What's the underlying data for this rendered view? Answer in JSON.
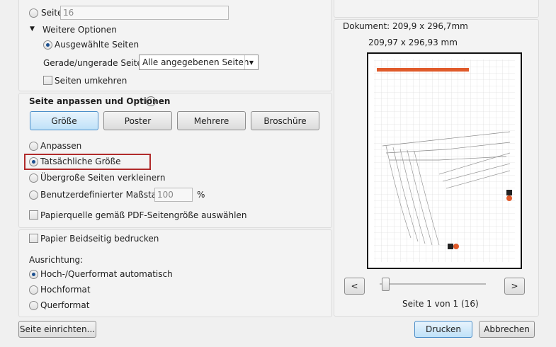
{
  "pages": {
    "label": "Seiten",
    "value": "16"
  },
  "more_options": {
    "label": "Weitere Optionen"
  },
  "selected_pages": {
    "label": "Ausgewählte Seiten"
  },
  "even_odd": {
    "label": "Gerade/ungerade Seiten:",
    "value": "Alle angegebenen Seiten"
  },
  "reverse_pages": {
    "label": "Seiten umkehren"
  },
  "page_sizing": {
    "title": "Seite anpassen und Optionen",
    "buttons": [
      "Größe",
      "Poster",
      "Mehrere",
      "Broschüre"
    ],
    "fit": "Anpassen",
    "actual_size": "Tatsächliche Größe",
    "shrink": "Übergroße Seiten verkleinern",
    "custom_scale": "Benutzerdefinierter Maßstab:",
    "scale_value": "100",
    "scale_unit": "%",
    "paper_source": "Papierquelle gemäß PDF-Seitengröße auswählen"
  },
  "duplex": {
    "label": "Papier Beidseitig bedrucken"
  },
  "orientation": {
    "title": "Ausrichtung:",
    "options": [
      "Hoch-/Querformat automatisch",
      "Hochformat",
      "Querformat"
    ]
  },
  "preview": {
    "document_size": "Dokument: 209,9 x 296,7mm",
    "paper_size": "209,97 x 296,93 mm",
    "page_info": "Seite 1 von 1 (16)",
    "prev": "<",
    "next": ">"
  },
  "footer": {
    "page_setup": "Seite einrichten...",
    "print": "Drucken",
    "cancel": "Abbrechen"
  }
}
